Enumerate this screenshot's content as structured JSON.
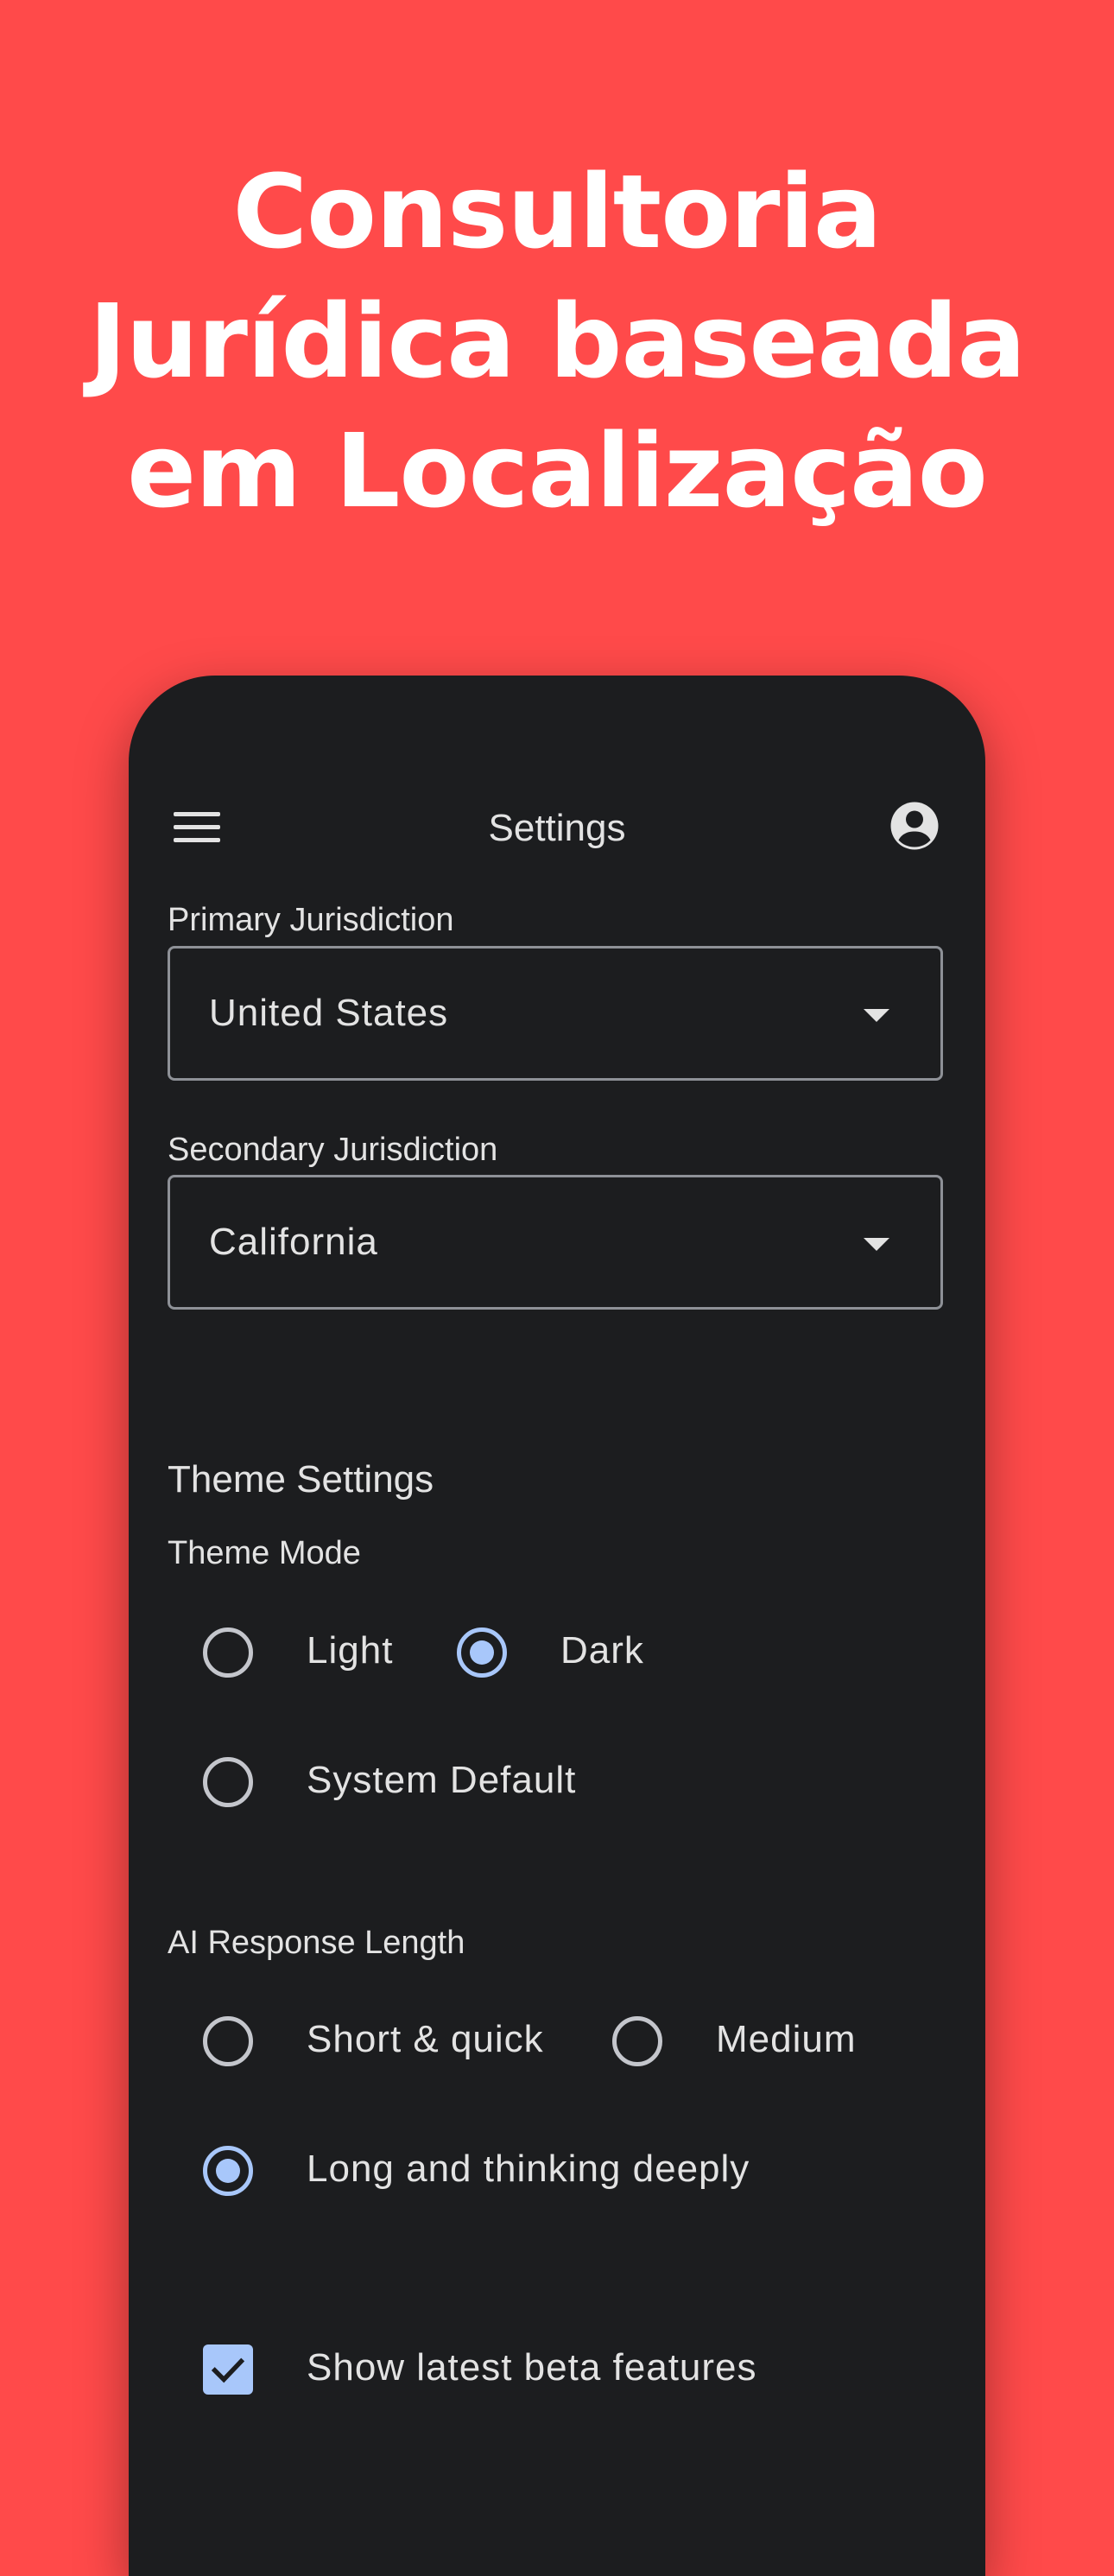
{
  "headline": {
    "line1": "Consultoria",
    "line2": "Jurídica baseada",
    "line3": "em Localização"
  },
  "colors": {
    "background": "#FF4A4A",
    "phone_surface": "#1C1D1F",
    "accent": "#A8C7FA",
    "text": "#E3E3E3"
  },
  "topbar": {
    "title": "Settings",
    "left_icon": "menu-icon",
    "right_icon": "account-circle-icon"
  },
  "jurisdiction": {
    "primary_label": "Primary Jurisdiction",
    "primary_value": "United States",
    "secondary_label": "Secondary Jurisdiction",
    "secondary_value": "California"
  },
  "theme": {
    "section_title": "Theme Settings",
    "mode_label": "Theme Mode",
    "options": [
      {
        "label": "Light",
        "selected": false
      },
      {
        "label": "Dark",
        "selected": true
      },
      {
        "label": "System Default",
        "selected": false
      }
    ]
  },
  "ai_response": {
    "label": "AI Response Length",
    "options": [
      {
        "label": "Short & quick",
        "selected": false
      },
      {
        "label": "Medium",
        "selected": false
      },
      {
        "label": "Long and thinking deeply",
        "selected": true
      }
    ]
  },
  "beta": {
    "label": "Show latest beta features",
    "checked": true
  }
}
